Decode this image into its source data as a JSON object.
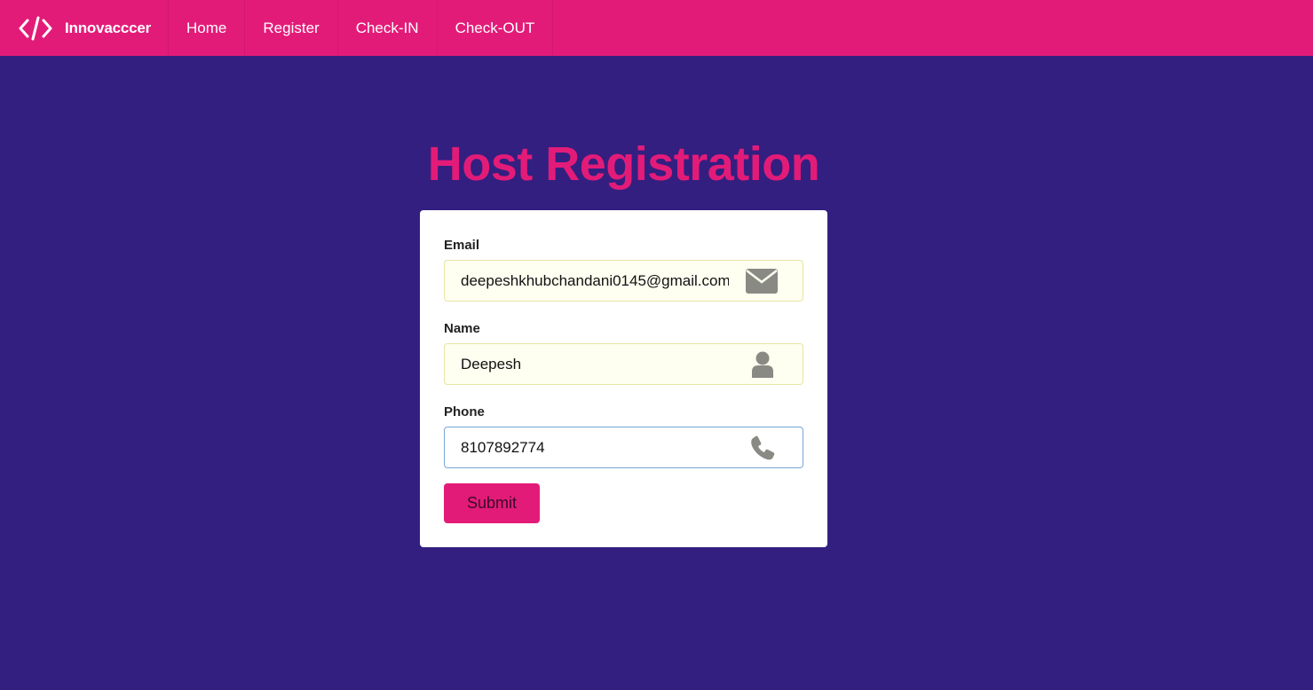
{
  "navbar": {
    "brand": "Innovacccer",
    "items": [
      {
        "label": "Home"
      },
      {
        "label": "Register"
      },
      {
        "label": "Check-IN"
      },
      {
        "label": "Check-OUT"
      }
    ],
    "color": "#e31b78"
  },
  "page": {
    "title": "Host Registration",
    "background": "#331f80"
  },
  "form": {
    "email": {
      "label": "Email",
      "value": "deepeshkhubchandani0145@gmail.com",
      "icon": "envelope-icon"
    },
    "name": {
      "label": "Name",
      "value": "Deepesh",
      "icon": "user-icon"
    },
    "phone": {
      "label": "Phone",
      "value": "8107892774",
      "icon": "phone-icon"
    },
    "submit_label": "Submit"
  }
}
